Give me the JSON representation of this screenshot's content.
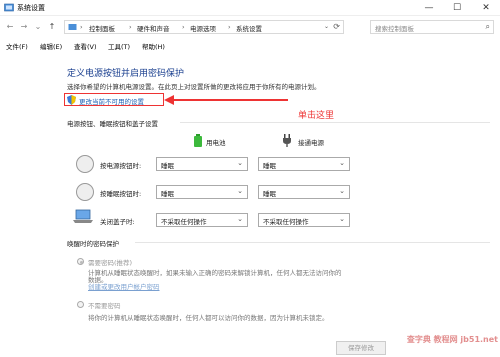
{
  "window": {
    "title": "系统设置",
    "min": "—",
    "max": "☐",
    "close": "✕"
  },
  "nav": {
    "back": "←",
    "forward": "→",
    "down": "⌄",
    "up": "↑",
    "breadcrumbs": [
      "控制面板",
      "硬件和声音",
      "电源选项",
      "系统设置"
    ],
    "separator": "›",
    "dropdown": "⌄",
    "refresh": "⟳",
    "search_placeholder": "搜索控制面板",
    "search_icon": "⌕"
  },
  "menu": [
    "文件(F)",
    "编辑(E)",
    "查看(V)",
    "工具(T)",
    "帮助(H)"
  ],
  "heading": "定义电源按钮并启用密码保护",
  "subtext": "选择你希望的计算机电源设置。在此页上对设置所做的更改将应用于你所有的电源计划。",
  "change_link": "更改当前不可用的设置",
  "annotation": "单击这里",
  "section1": {
    "title": "电源按钮、睡眠按钮和盖子设置",
    "columns": [
      "用电池",
      "接通电源"
    ],
    "rows": [
      {
        "label": "按电源按钮时:",
        "battery": "睡眠",
        "plugged": "睡眠",
        "chev": "⌄"
      },
      {
        "label": "按睡眠按钮时:",
        "battery": "睡眠",
        "plugged": "睡眠",
        "chev": "⌄"
      },
      {
        "label": "关闭盖子时:",
        "battery": "不采取任何操作",
        "plugged": "不采取任何操作",
        "chev": "⌄"
      }
    ]
  },
  "section2": {
    "title": "唤醒时的密码保护",
    "option1": "需要密码(推荐)",
    "option1_desc_line1": "计算机从睡眠状态唤醒时，如果未输入正确的密码来解锁计算机，任何人都无法访问你的",
    "option1_desc_line2": "数据。",
    "option1_link": "创建或更改用户帐户密码",
    "option2": "不需要密码",
    "option2_desc": "将你的计算机从睡眠状态唤醒时，任何人都可以访问你的数据，因为计算机未锁定。"
  },
  "save_button": "保存修改",
  "watermark": "查字典 教程网 jb51.net",
  "colors": {
    "heading": "#1a3f8f",
    "link": "#1a5fb4",
    "annotation": "#ee3333"
  }
}
